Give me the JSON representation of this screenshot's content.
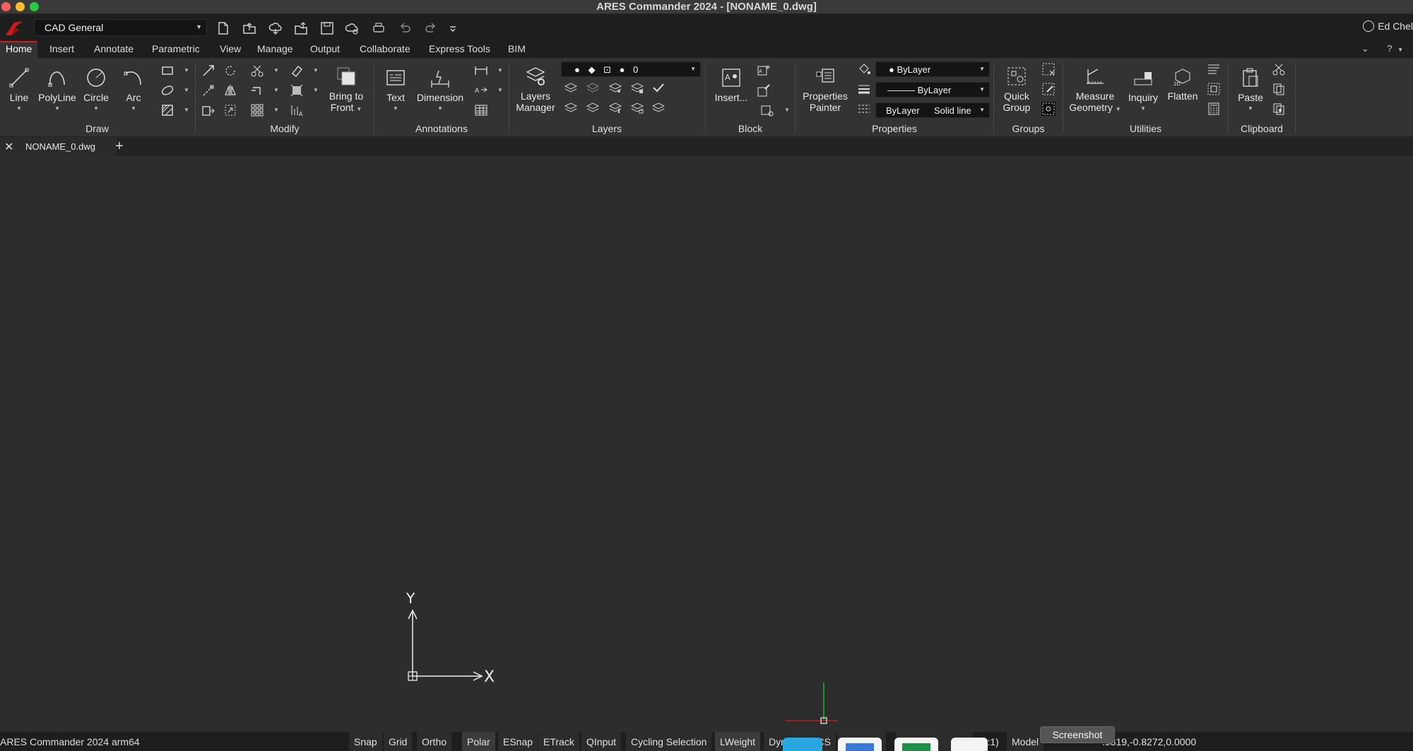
{
  "window": {
    "title": "ARES Commander 2024 - [NONAME_0.dwg]"
  },
  "quick_access": {
    "workspace": "CAD General",
    "user": "Ed Chel",
    "icons": [
      "new-file-icon",
      "open-file-icon",
      "cloud-icon",
      "upload-icon",
      "save-icon",
      "save-cloud-icon",
      "print-icon",
      "undo-icon",
      "redo-icon",
      "customize-icon"
    ]
  },
  "tabs": [
    {
      "label": "Home"
    },
    {
      "label": "Insert"
    },
    {
      "label": "Annotate"
    },
    {
      "label": "Parametric"
    },
    {
      "label": "View"
    },
    {
      "label": "Manage"
    },
    {
      "label": "Output"
    },
    {
      "label": "Collaborate"
    },
    {
      "label": "Express Tools"
    },
    {
      "label": "BIM"
    }
  ],
  "tabs_right": {
    "help": "?"
  },
  "ribbon": {
    "panels": {
      "draw": "Draw",
      "modify": "Modify",
      "annotations": "Annotations",
      "layers": "Layers",
      "block": "Block",
      "properties": "Properties",
      "groups": "Groups",
      "utilities": "Utilities",
      "clipboard": "Clipboard"
    },
    "buttons": {
      "line": "Line",
      "polyline": "PolyLine",
      "circle": "Circle",
      "arc": "Arc",
      "bring_to_front_1": "Bring to",
      "bring_to_front_2": "Front",
      "text": "Text",
      "dimension": "Dimension",
      "layers_manager_1": "Layers",
      "layers_manager_2": "Manager",
      "insert": "Insert...",
      "properties_painter_1": "Properties",
      "properties_painter_2": "Painter",
      "quick_group_1": "Quick",
      "quick_group_2": "Group",
      "measure_geometry_1": "Measure",
      "measure_geometry_2": "Geometry",
      "inquiry": "Inquiry",
      "flatten": "Flatten",
      "paste": "Paste"
    },
    "layer_combo": "0",
    "color_combo": "ByLayer",
    "linetype_combo": "ByLayer",
    "lineweight_combo": "ByLayer",
    "linestyle_combo": "Solid line"
  },
  "document": {
    "tab_name": "NONAME_0.dwg"
  },
  "canvas": {
    "ucs_x": "X",
    "ucs_y": "Y"
  },
  "statusbar": {
    "app_version": "ARES Commander 2024 arm64",
    "toggles": [
      {
        "label": "Snap",
        "on": false
      },
      {
        "label": "Grid",
        "on": false
      },
      {
        "label": "Ortho",
        "on": false
      },
      {
        "label": "Polar",
        "on": true
      },
      {
        "label": "ESnap",
        "on": false
      },
      {
        "label": "ETrack",
        "on": false
      },
      {
        "label": "QInput",
        "on": false
      },
      {
        "label": "Cycling Selection",
        "on": false
      },
      {
        "label": "LWeight",
        "on": true
      },
      {
        "label": "Dynamic CCS",
        "on": false
      }
    ],
    "scale": "(1:1)",
    "model": "Model",
    "coordinates": ".9319,-0.8272,0.0000",
    "tooltip": "Screenshot"
  },
  "colors": {
    "accent": "#d11a1a",
    "ucs_green": "#22c43a",
    "ucs_red": "#d01c1c"
  }
}
